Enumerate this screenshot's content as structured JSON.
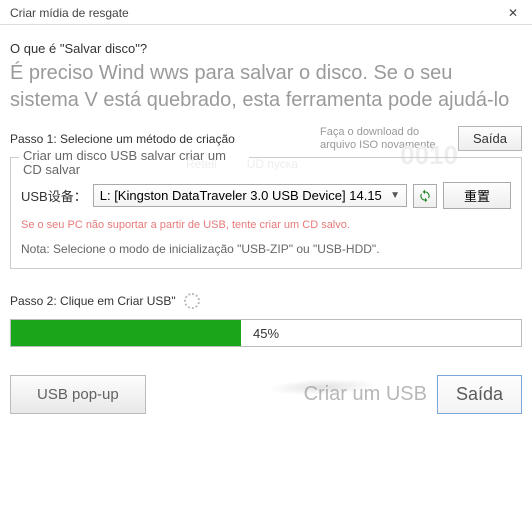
{
  "title": "Criar mídia de resgate",
  "question": "O que é \"Salvar disco\"?",
  "description": "É preciso Wind wws para salvar o disco. Se o seu sistema V está quebrado, esta ferramenta pode ajudá-lo",
  "ghost_numbers": "0010",
  "step1": {
    "label": "Passo 1: Selecione um método de criação",
    "iso_link": "Faça o download do arquivo ISO novamente",
    "exit_btn": "Saída"
  },
  "fieldset": {
    "label": "Criar um disco USB salvar criar um CD salvar",
    "ghost_tab1": "Retell",
    "ghost_tab2": "UD пуска",
    "usb_label": "USB设备：",
    "usb_selected": "L: [Kingston DataTraveler 3.0 USB Device] 14.15",
    "reset_btn": "重置",
    "warn": "Se o seu PC não suportar a partir de USB, tente criar um CD salvo.",
    "note": "Nota: Selecione o modo de inicialização \"USB-ZIP\" ou \"USB-HDD\"."
  },
  "step2": {
    "label": "Passo 2: Clique em Criar USB\"",
    "progress_value": 45,
    "progress_text": "45%"
  },
  "bottom": {
    "usb_popup": "USB pop-up",
    "criar_label": "Criar um USB",
    "saida": "Saída"
  }
}
